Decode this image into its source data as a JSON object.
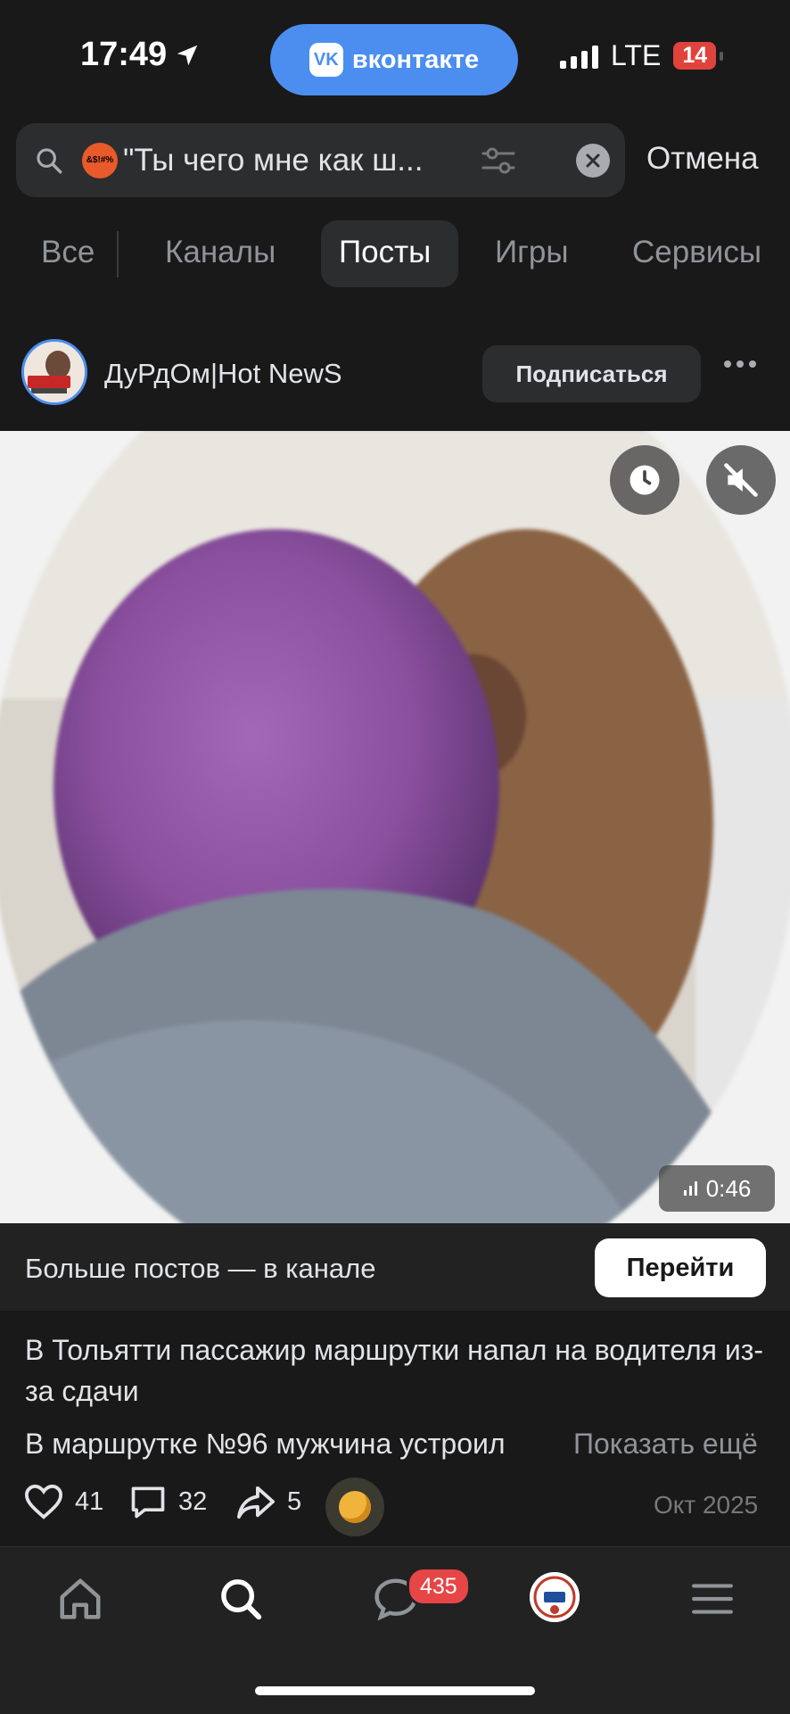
{
  "status_bar": {
    "time": "17:49",
    "app_pill": "вконтакте",
    "network": "LTE",
    "battery": "14"
  },
  "search": {
    "emoji_text": "&$!#%",
    "query": "\"Ты чего мне как ш...",
    "cancel_label": "Отмена"
  },
  "tabs": [
    {
      "label": "Все",
      "active": false
    },
    {
      "label": "Каналы",
      "active": false
    },
    {
      "label": "Посты",
      "active": true
    },
    {
      "label": "Игры",
      "active": false
    },
    {
      "label": "Сервисы",
      "active": false
    }
  ],
  "post": {
    "channel_name": "ДуРдОм|Hot NewS",
    "subscribe_label": "Подписаться",
    "video_duration": "0:46",
    "more_posts_text": "Больше постов — в канале",
    "go_label": "Перейти",
    "title": "В Тольятти пассажир маршрутки напал на водителя из-за сдачи",
    "body_preview": "В маршрутке №96 мужчина устроил",
    "show_more": "Показать ещё",
    "likes": "41",
    "comments": "32",
    "shares": "5",
    "date": "Окт 2025"
  },
  "bottom_nav": {
    "messages_badge": "435"
  },
  "colors": {
    "accent": "#4b8ef0",
    "background": "#19191a",
    "badge": "#e64646"
  }
}
